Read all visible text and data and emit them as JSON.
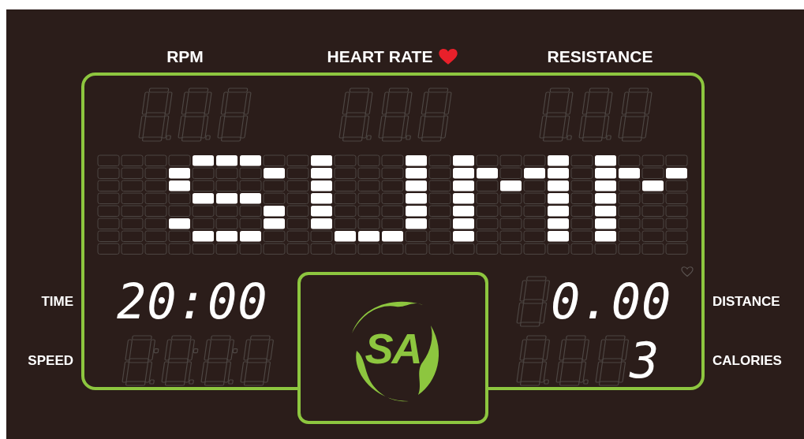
{
  "header": {
    "items": [
      {
        "text": "RPM",
        "kind": "plain"
      },
      {
        "text": "HEART RATE",
        "kind": "heart"
      },
      {
        "text": "RESISTANCE",
        "kind": "plain"
      }
    ]
  },
  "readout_rows": [
    {
      "left": {
        "label": "TIME",
        "value": "20:00"
      },
      "right": {
        "label": "DISTANCE",
        "value": "0.00"
      }
    },
    {
      "left": {
        "label": "SPEED"
      },
      "right": {
        "label": "CALORIES",
        "value": "3"
      }
    }
  ],
  "logo": {
    "text": "SA"
  }
}
